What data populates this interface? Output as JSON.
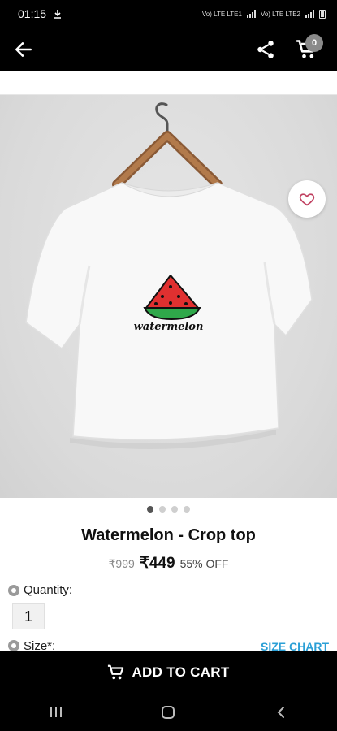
{
  "status_bar": {
    "time": "01:15",
    "network_1": "Vo) LTE LTE1",
    "network_2": "Vo) LTE LTE2"
  },
  "app_bar": {
    "back_icon": "arrow-left-icon",
    "share_icon": "share-icon",
    "cart_icon": "cart-icon",
    "cart_count": "0"
  },
  "product": {
    "image_print_text": "watermelon",
    "wishlist_icon": "heart-outline-icon",
    "carousel_total": 4,
    "carousel_active": 1,
    "title": "Watermelon - Crop top",
    "mrp": "₹999",
    "price": "₹449",
    "discount": "55% OFF"
  },
  "options": {
    "quantity_label": "Quantity:",
    "quantity_value": "1",
    "size_label": "Size*:",
    "size_chart_label": "SIZE CHART"
  },
  "footer": {
    "add_to_cart_label": "ADD TO CART"
  },
  "colors": {
    "bar_background": "#000000",
    "link_blue": "#2a9fd6",
    "badge_gray": "#8a8a8a"
  }
}
